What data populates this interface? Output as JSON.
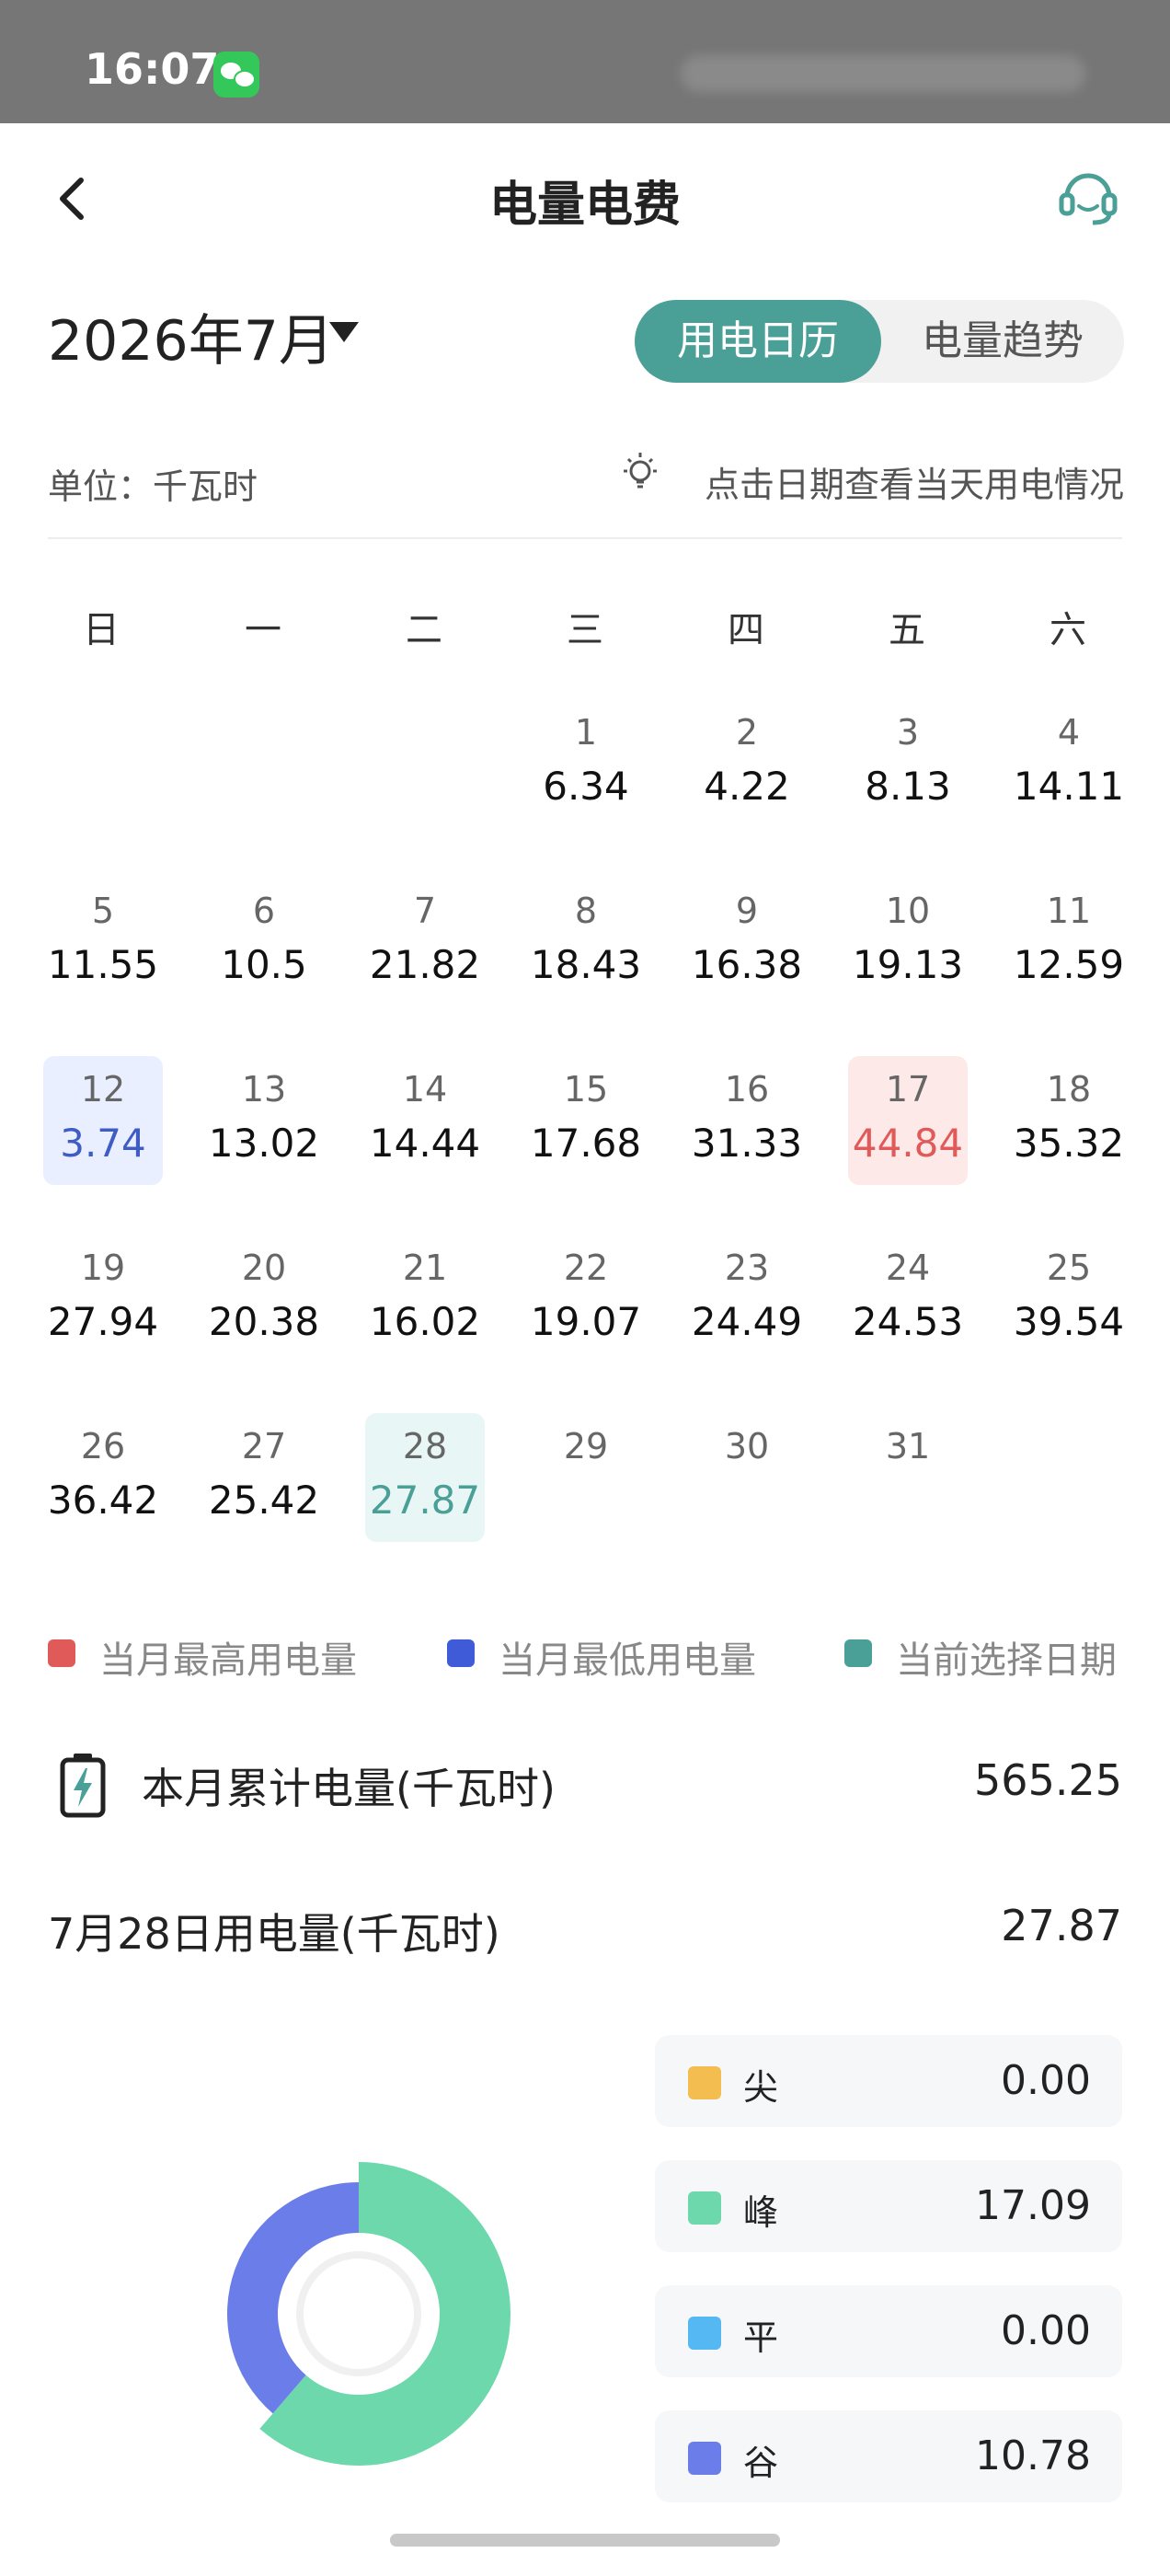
{
  "status_bar": {
    "time": "16:07"
  },
  "header": {
    "title": "电量电费"
  },
  "month_selector": {
    "label": "2026年7月"
  },
  "view_toggle": {
    "active": "用电日历",
    "inactive": "电量趋势"
  },
  "unit_label": "单位：千瓦时",
  "hint": "点击日期查看当天用电情况",
  "weekdays": [
    "日",
    "一",
    "二",
    "三",
    "四",
    "五",
    "六"
  ],
  "calendar": {
    "days": [
      {
        "day": "1",
        "value": "6.34"
      },
      {
        "day": "2",
        "value": "4.22"
      },
      {
        "day": "3",
        "value": "8.13"
      },
      {
        "day": "4",
        "value": "14.11"
      },
      {
        "day": "5",
        "value": "11.55"
      },
      {
        "day": "6",
        "value": "10.5"
      },
      {
        "day": "7",
        "value": "21.82"
      },
      {
        "day": "8",
        "value": "18.43"
      },
      {
        "day": "9",
        "value": "16.38"
      },
      {
        "day": "10",
        "value": "19.13"
      },
      {
        "day": "11",
        "value": "12.59"
      },
      {
        "day": "12",
        "value": "3.74",
        "state": "low"
      },
      {
        "day": "13",
        "value": "13.02"
      },
      {
        "day": "14",
        "value": "14.44"
      },
      {
        "day": "15",
        "value": "17.68"
      },
      {
        "day": "16",
        "value": "31.33"
      },
      {
        "day": "17",
        "value": "44.84",
        "state": "high"
      },
      {
        "day": "18",
        "value": "35.32"
      },
      {
        "day": "19",
        "value": "27.94"
      },
      {
        "day": "20",
        "value": "20.38"
      },
      {
        "day": "21",
        "value": "16.02"
      },
      {
        "day": "22",
        "value": "19.07"
      },
      {
        "day": "23",
        "value": "24.49"
      },
      {
        "day": "24",
        "value": "24.53"
      },
      {
        "day": "25",
        "value": "39.54"
      },
      {
        "day": "26",
        "value": "36.42"
      },
      {
        "day": "27",
        "value": "25.42"
      },
      {
        "day": "28",
        "value": "27.87",
        "state": "selected"
      },
      {
        "day": "29",
        "value": ""
      },
      {
        "day": "30",
        "value": ""
      },
      {
        "day": "31",
        "value": ""
      }
    ]
  },
  "legend": [
    {
      "label": "当月最高用电量",
      "color": "#e05a5a"
    },
    {
      "label": "当月最低用电量",
      "color": "#3f5bd8"
    },
    {
      "label": "当前选择日期",
      "color": "#4a9f97"
    }
  ],
  "monthly_total": {
    "label": "本月累计电量(千瓦时)",
    "value": "565.25"
  },
  "selected_day": {
    "label": "7月28日用电量(千瓦时)",
    "value": "27.87"
  },
  "breakdown": [
    {
      "name": "尖",
      "value": "0.00",
      "color": "#f4bd4f"
    },
    {
      "name": "峰",
      "value": "17.09",
      "color": "#6dd8ac"
    },
    {
      "name": "平",
      "value": "0.00",
      "color": "#55b8f2"
    },
    {
      "name": "谷",
      "value": "10.78",
      "color": "#6b7de8"
    }
  ],
  "icons": {
    "back": "back-arrow-icon",
    "service": "headset-icon",
    "dropdown": "caret-down-icon",
    "hint": "lightbulb-icon",
    "total": "battery-charging-icon"
  }
}
